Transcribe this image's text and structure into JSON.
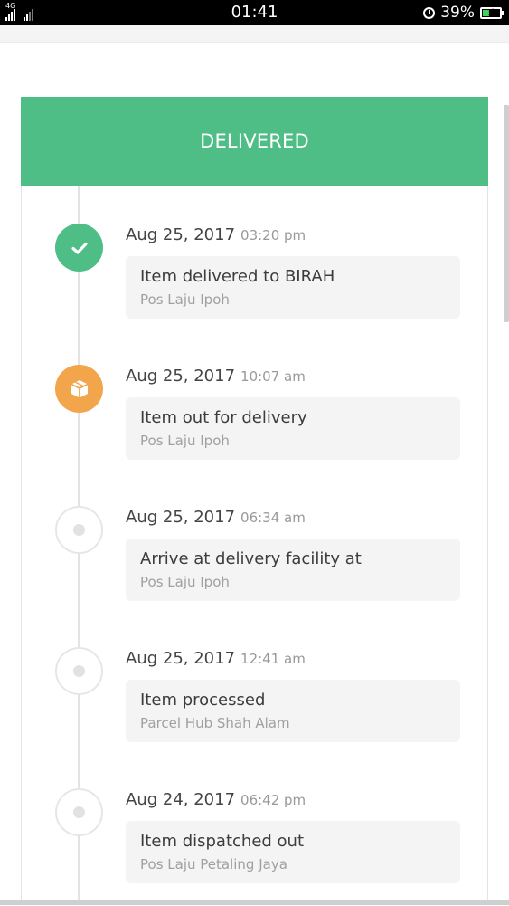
{
  "status_bar": {
    "network": "4G",
    "time": "01:41",
    "battery_percent": "39%",
    "battery_level": 0.39,
    "icons": [
      "signal-icon",
      "signal-icon",
      "alarm-icon",
      "battery-icon"
    ]
  },
  "banner": {
    "label": "DELIVERED",
    "color": "#4fbd86"
  },
  "events": [
    {
      "date": "Aug 25, 2017",
      "time": "03:20 pm",
      "status": "Item delivered to BIRAH",
      "location": "Pos Laju Ipoh",
      "icon": "check-icon",
      "color": "#4fbd86"
    },
    {
      "date": "Aug 25, 2017",
      "time": "10:07 am",
      "status": "Item out for delivery",
      "location": "Pos Laju Ipoh",
      "icon": "box-icon",
      "color": "#f3a54b"
    },
    {
      "date": "Aug 25, 2017",
      "time": "06:34 am",
      "status": "Arrive at delivery facility at",
      "location": "Pos Laju Ipoh",
      "icon": "dot-icon"
    },
    {
      "date": "Aug 25, 2017",
      "time": "12:41 am",
      "status": "Item processed",
      "location": "Parcel Hub Shah Alam",
      "icon": "dot-icon"
    },
    {
      "date": "Aug 24, 2017",
      "time": "06:42 pm",
      "status": "Item dispatched out",
      "location": "Pos Laju Petaling Jaya",
      "icon": "dot-icon"
    }
  ]
}
